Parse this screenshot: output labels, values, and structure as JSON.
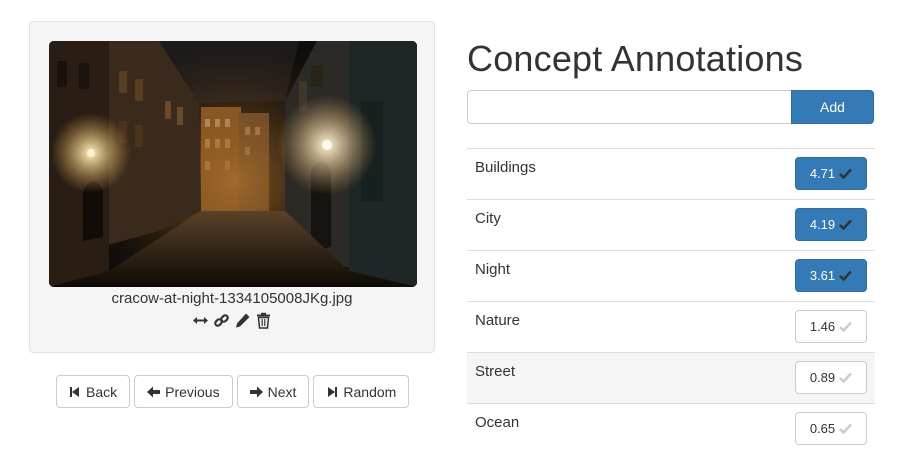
{
  "image": {
    "filename": "cracow-at-night-1334105008JKg.jpg",
    "alt": "Night street in Cracow"
  },
  "tools": [
    {
      "name": "resize-icon",
      "icon": "arrows-horizontal"
    },
    {
      "name": "link-icon",
      "icon": "link"
    },
    {
      "name": "edit-icon",
      "icon": "pencil"
    },
    {
      "name": "delete-icon",
      "icon": "trash"
    }
  ],
  "nav": {
    "back": "Back",
    "previous": "Previous",
    "next": "Next",
    "random": "Random"
  },
  "annotations": {
    "title": "Concept Annotations",
    "input_value": "",
    "input_placeholder": "",
    "add_label": "Add"
  },
  "concepts": [
    {
      "label": "Buildings",
      "score": "4.71",
      "selected": true
    },
    {
      "label": "City",
      "score": "4.19",
      "selected": true
    },
    {
      "label": "Night",
      "score": "3.61",
      "selected": true
    },
    {
      "label": "Nature",
      "score": "1.46",
      "selected": false
    },
    {
      "label": "Street",
      "score": "0.89",
      "selected": false
    },
    {
      "label": "Ocean",
      "score": "0.65",
      "selected": false
    }
  ],
  "colors": {
    "primary": "#337ab7",
    "panel_bg": "#f5f5f5",
    "row_highlight": "#f5f5f5"
  }
}
